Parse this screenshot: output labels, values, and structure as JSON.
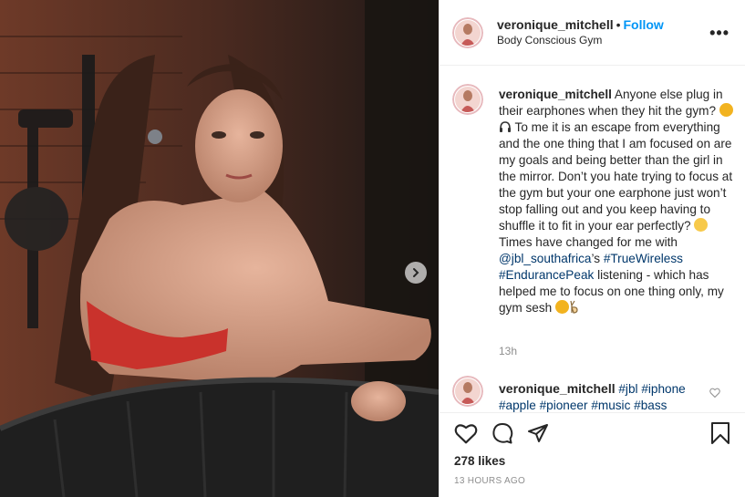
{
  "post": {
    "username": "veronique_mitchell",
    "follow_label": "Follow",
    "location": "Body Conscious Gym"
  },
  "caption": {
    "username": "veronique_mitchell",
    "part1": "Anyone else plug in their earphones when they hit the gym?",
    "part2": " To me it is an escape from everything and the one thing that I am focused on are my goals and being better than the girl in the mirror. Don’t you hate trying to focus at the gym but your one earphone just won’t stop falling out and you keep having to shuffle it to fit in your ear perfectly?",
    "part3": " Times have changed for me with ",
    "mention": "@jbl_southafrica",
    "part4": "’s ",
    "hashtag1": "#TrueWireless",
    "hashtag2": "#EndurancePeak",
    "part5": " listening - which has helped me to focus on one thing only, my gym sesh ",
    "time": "13h"
  },
  "comment": {
    "username": "veronique_mitchell",
    "hashtags": [
      "#jbl",
      "#iphone",
      "#apple",
      "#pioneer",
      "#music",
      "#bass"
    ]
  },
  "footer": {
    "likes": "278 likes",
    "timestamp": "13 HOURS AGO"
  },
  "icons": {
    "next": "chevron-right-icon",
    "like": "heart-icon",
    "comment": "comment-icon",
    "share": "paper-plane-icon",
    "save": "bookmark-icon",
    "more": "more-icon"
  },
  "colors": {
    "link": "#0095f6",
    "hashtag": "#00376b",
    "muted": "#8e8e8e",
    "border": "#efefef"
  }
}
